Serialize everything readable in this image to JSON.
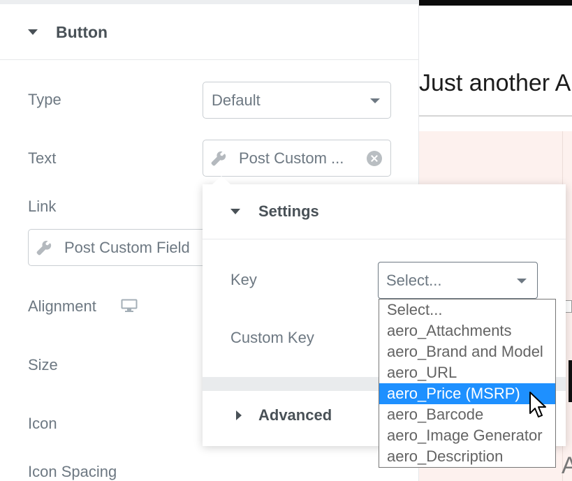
{
  "preview": {
    "tagline": "Just another A",
    "letter": "A"
  },
  "panel": {
    "section_title": "Button",
    "type": {
      "label": "Type",
      "value": "Default"
    },
    "text": {
      "label": "Text",
      "value": "Post Custom ..."
    },
    "link": {
      "label": "Link",
      "value": "Post Custom Field"
    },
    "alignment": {
      "label": "Alignment"
    },
    "size": {
      "label": "Size"
    },
    "icon": {
      "label": "Icon"
    },
    "icon_spacing": {
      "label": "Icon Spacing"
    }
  },
  "popover": {
    "settings_title": "Settings",
    "key_label": "Key",
    "key_value": "Select...",
    "custom_key_label": "Custom Key",
    "advanced_title": "Advanced",
    "options": [
      "Select...",
      "aero_Attachments",
      "aero_Brand and Model",
      "aero_URL",
      "aero_Price (MSRP)",
      "aero_Barcode",
      "aero_Image Generator",
      "aero_Description"
    ],
    "highlighted_index": 4
  },
  "icons": {
    "section_caret": "caret-down-icon",
    "select_chevron": "chevron-down-icon",
    "dynamic": "wrench-icon",
    "clear": "clear-icon",
    "responsive": "desktop-icon",
    "advanced_caret": "caret-right-icon",
    "pointer": "mouse-cursor-icon"
  },
  "colors": {
    "highlight": "#1e90ff",
    "text": "#6d7882",
    "heading": "#495157"
  }
}
